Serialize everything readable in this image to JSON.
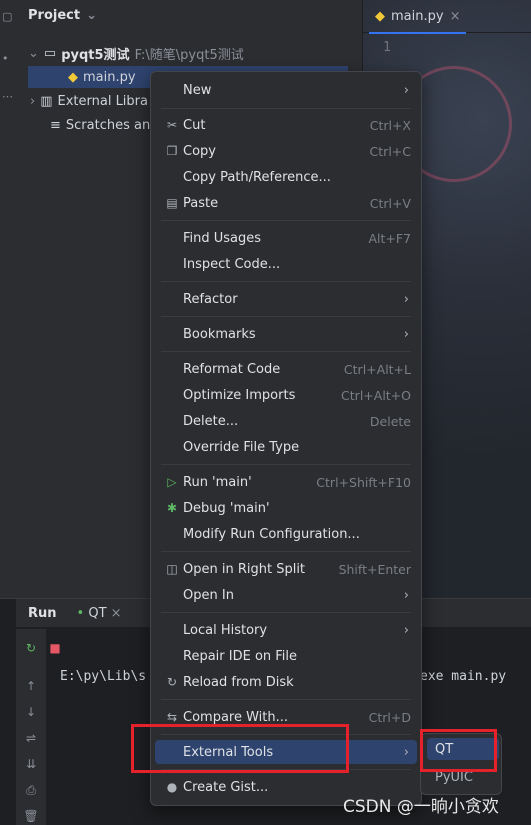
{
  "project_panel": {
    "title": "Project",
    "root_folder": "pyqt5测试",
    "root_path": "F:\\随笔\\pyqt5测试",
    "file": "main.py",
    "external_libraries": "External Libra",
    "scratches": "Scratches an"
  },
  "editor": {
    "tab": "main.py",
    "line_number": "1"
  },
  "run_panel": {
    "tab_run": "Run",
    "tab_config": "QT",
    "console_left": "E:\\py\\Lib\\s",
    "console_right": "exe main.py"
  },
  "context_menu": {
    "items": [
      {
        "label": "New",
        "shortcut": "",
        "submenu": true,
        "icon": ""
      },
      {
        "label": "Cut",
        "shortcut": "Ctrl+X",
        "submenu": false,
        "icon": "cut-icon"
      },
      {
        "label": "Copy",
        "shortcut": "Ctrl+C",
        "submenu": false,
        "icon": "copy-icon"
      },
      {
        "label": "Copy Path/Reference...",
        "shortcut": "",
        "submenu": false,
        "icon": ""
      },
      {
        "label": "Paste",
        "shortcut": "Ctrl+V",
        "submenu": false,
        "icon": "paste-icon"
      },
      {
        "label": "Find Usages",
        "shortcut": "Alt+F7",
        "submenu": false,
        "icon": ""
      },
      {
        "label": "Inspect Code...",
        "shortcut": "",
        "submenu": false,
        "icon": ""
      },
      {
        "label": "Refactor",
        "shortcut": "",
        "submenu": true,
        "icon": ""
      },
      {
        "label": "Bookmarks",
        "shortcut": "",
        "submenu": true,
        "icon": ""
      },
      {
        "label": "Reformat Code",
        "shortcut": "Ctrl+Alt+L",
        "submenu": false,
        "icon": ""
      },
      {
        "label": "Optimize Imports",
        "shortcut": "Ctrl+Alt+O",
        "submenu": false,
        "icon": ""
      },
      {
        "label": "Delete...",
        "shortcut": "Delete",
        "submenu": false,
        "icon": ""
      },
      {
        "label": "Override File Type",
        "shortcut": "",
        "submenu": false,
        "icon": ""
      },
      {
        "label": "Run 'main'",
        "shortcut": "Ctrl+Shift+F10",
        "submenu": false,
        "icon": "run-icon"
      },
      {
        "label": "Debug 'main'",
        "shortcut": "",
        "submenu": false,
        "icon": "debug-icon"
      },
      {
        "label": "Modify Run Configuration...",
        "shortcut": "",
        "submenu": false,
        "icon": ""
      },
      {
        "label": "Open in Right Split",
        "shortcut": "Shift+Enter",
        "submenu": false,
        "icon": "split-icon"
      },
      {
        "label": "Open In",
        "shortcut": "",
        "submenu": true,
        "icon": ""
      },
      {
        "label": "Local History",
        "shortcut": "",
        "submenu": true,
        "icon": ""
      },
      {
        "label": "Repair IDE on File",
        "shortcut": "",
        "submenu": false,
        "icon": ""
      },
      {
        "label": "Reload from Disk",
        "shortcut": "",
        "submenu": false,
        "icon": "reload-icon"
      },
      {
        "label": "Compare With...",
        "shortcut": "Ctrl+D",
        "submenu": false,
        "icon": "compare-icon"
      },
      {
        "label": "External Tools",
        "shortcut": "",
        "submenu": true,
        "icon": ""
      },
      {
        "label": "Create Gist...",
        "shortcut": "",
        "submenu": false,
        "icon": "github-icon"
      }
    ]
  },
  "submenu": {
    "items": [
      "QT",
      "PyUIC"
    ]
  },
  "watermark": "CSDN @一晌小贪欢"
}
